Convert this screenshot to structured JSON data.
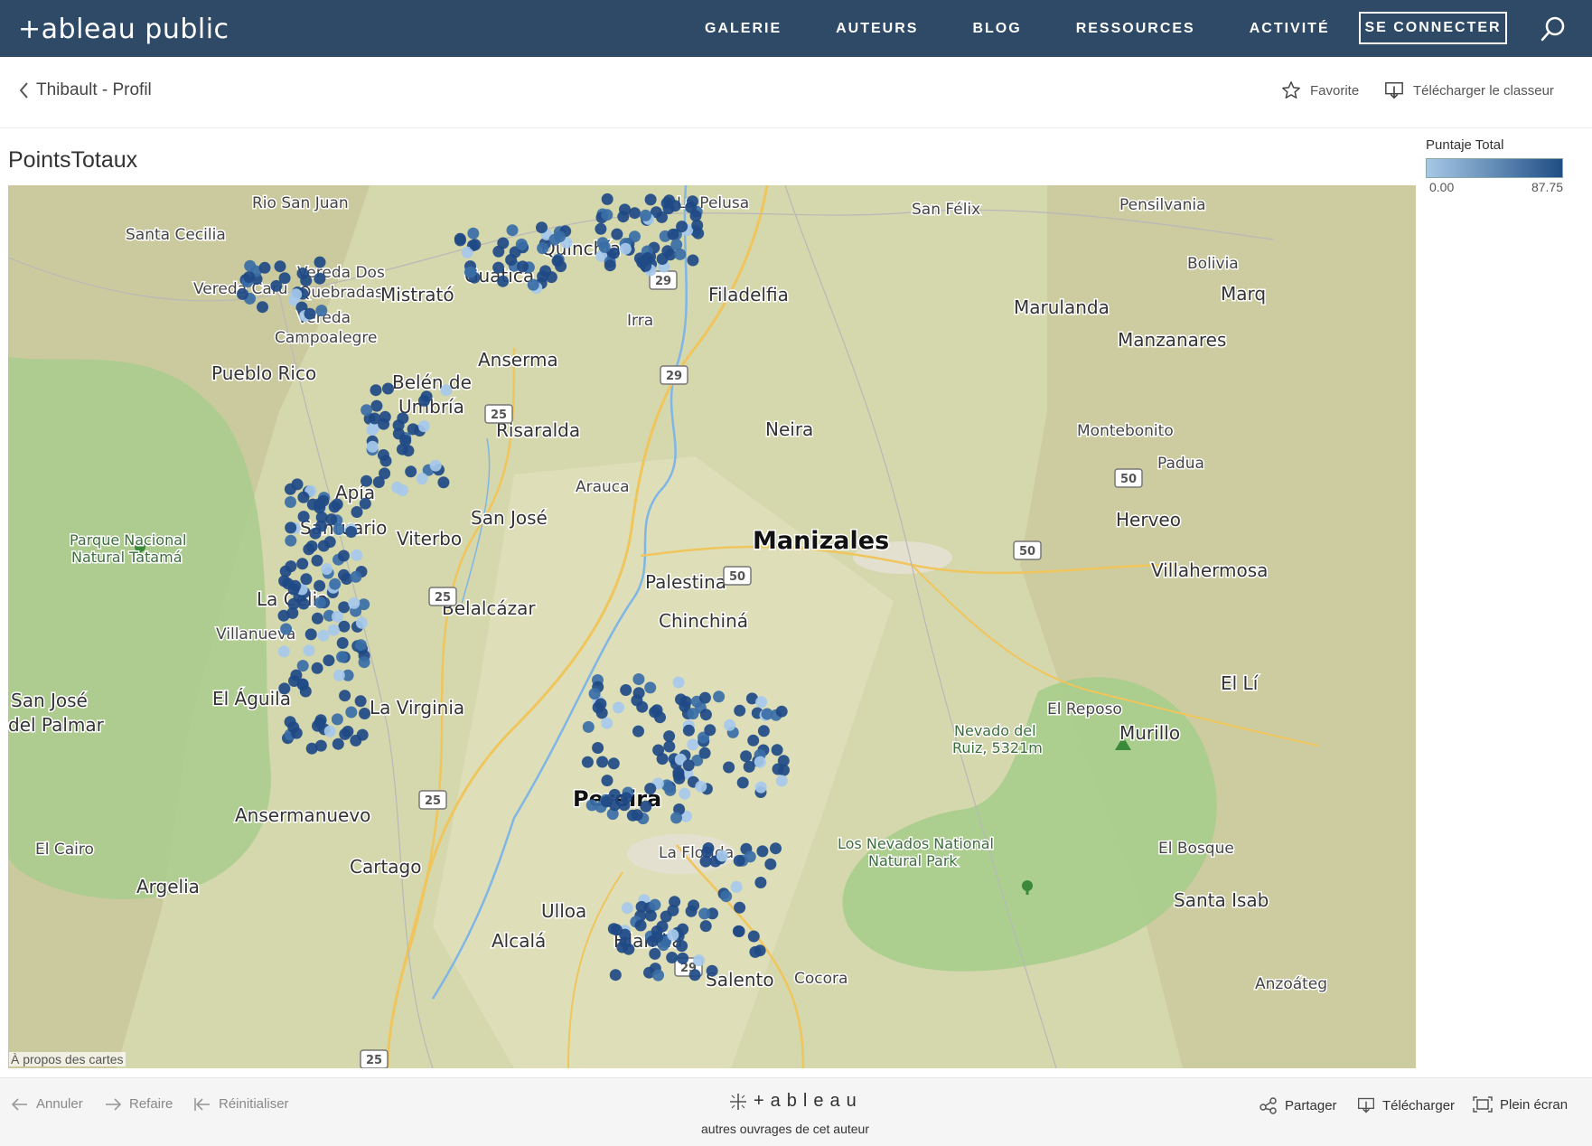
{
  "nav": {
    "logo": "+ableau public",
    "links": [
      "GALERIE",
      "AUTEURS",
      "BLOG",
      "RESSOURCES",
      "ACTIVITÉ"
    ],
    "login": "SE CONNECTER"
  },
  "subheader": {
    "back": "Thibault - Profil",
    "favorite": "Favorite",
    "download_workbook": "Télécharger le classeur"
  },
  "viz": {
    "title": "PointsTotaux",
    "legend": {
      "title": "Puntaje Total",
      "min": "0.00",
      "max": "87.75",
      "color_low": "#a7c8e6",
      "color_high": "#1f4e85"
    },
    "attribution": "À propos des cartes"
  },
  "map_labels": [
    {
      "text": "Rio San Juan",
      "cls": "town"
    },
    {
      "text": "La Pelusa",
      "cls": "town"
    },
    {
      "text": "San Félix",
      "cls": "town"
    },
    {
      "text": "Pensilvania",
      "cls": "town"
    },
    {
      "text": "Santa Cecilia",
      "cls": "town"
    },
    {
      "text": "Vereda Dos",
      "cls": "town"
    },
    {
      "text": "Quebradas",
      "cls": "town"
    },
    {
      "text": "Vereda Caru",
      "cls": "town"
    },
    {
      "text": "Mistrató",
      "cls": "city"
    },
    {
      "text": "Guática",
      "cls": "city"
    },
    {
      "text": "Quinchía",
      "cls": "city"
    },
    {
      "text": "Filadelfia",
      "cls": "city"
    },
    {
      "text": "Bolivia",
      "cls": "town"
    },
    {
      "text": "Marulanda",
      "cls": "city"
    },
    {
      "text": "Marq",
      "cls": "city"
    },
    {
      "text": "Vereda",
      "cls": "town"
    },
    {
      "text": "Campoalegre",
      "cls": "town"
    },
    {
      "text": "Irra",
      "cls": "town"
    },
    {
      "text": "Manzanares",
      "cls": "city"
    },
    {
      "text": "Pueblo Rico",
      "cls": "city"
    },
    {
      "text": "Anserma",
      "cls": "city"
    },
    {
      "text": "Belén de",
      "cls": "city"
    },
    {
      "text": "Umbría",
      "cls": "city"
    },
    {
      "text": "Risaralda",
      "cls": "city"
    },
    {
      "text": "Neira",
      "cls": "city"
    },
    {
      "text": "Montebonito",
      "cls": "town"
    },
    {
      "text": "Padua",
      "cls": "town"
    },
    {
      "text": "Arauca",
      "cls": "town"
    },
    {
      "text": "Apía",
      "cls": "city"
    },
    {
      "text": "Santuario",
      "cls": "city"
    },
    {
      "text": "San José",
      "cls": "city"
    },
    {
      "text": "Viterbo",
      "cls": "city"
    },
    {
      "text": "Manizales",
      "cls": "capital"
    },
    {
      "text": "Herveo",
      "cls": "city"
    },
    {
      "text": "Parque Nacional",
      "cls": "park"
    },
    {
      "text": "Natural Tatamá",
      "cls": "park"
    },
    {
      "text": "Palestina",
      "cls": "city"
    },
    {
      "text": "Villahermosa",
      "cls": "city"
    },
    {
      "text": "La Celia",
      "cls": "city"
    },
    {
      "text": "Belalcázar",
      "cls": "city"
    },
    {
      "text": "Chinchiná",
      "cls": "city"
    },
    {
      "text": "Villanueva",
      "cls": "town"
    },
    {
      "text": "El Águila",
      "cls": "city"
    },
    {
      "text": "San José",
      "cls": "city"
    },
    {
      "text": "del Palmar",
      "cls": "city"
    },
    {
      "text": "La Virginia",
      "cls": "city"
    },
    {
      "text": "El Lí",
      "cls": "city"
    },
    {
      "text": "El Reposo",
      "cls": "town"
    },
    {
      "text": "Nevado del",
      "cls": "park"
    },
    {
      "text": "Ruiz, 5321m",
      "cls": "park"
    },
    {
      "text": "Murillo",
      "cls": "city"
    },
    {
      "text": "Pereira",
      "cls": "capital2"
    },
    {
      "text": "Ansermanuevo",
      "cls": "city"
    },
    {
      "text": "Los Nevados National",
      "cls": "park"
    },
    {
      "text": "Natural Park",
      "cls": "park"
    },
    {
      "text": "El Cairo",
      "cls": "town"
    },
    {
      "text": "La Florida",
      "cls": "town"
    },
    {
      "text": "El Bosque",
      "cls": "town"
    },
    {
      "text": "Cartago",
      "cls": "city"
    },
    {
      "text": "Argelia",
      "cls": "city"
    },
    {
      "text": "Santa Isab",
      "cls": "city"
    },
    {
      "text": "Ulloa",
      "cls": "city"
    },
    {
      "text": "Alcalá",
      "cls": "city"
    },
    {
      "text": "Filandia",
      "cls": "city"
    },
    {
      "text": "Salento",
      "cls": "city"
    },
    {
      "text": "Cocora",
      "cls": "town"
    },
    {
      "text": "Anzoáteg",
      "cls": "town"
    }
  ],
  "route_shields": [
    "29",
    "29",
    "25",
    "25",
    "25",
    "50",
    "50",
    "50",
    "29",
    "25"
  ],
  "toolbar": {
    "undo": "Annuler",
    "redo": "Refaire",
    "reset": "Réinitialiser",
    "brand": "+ableau",
    "other_works": "autres ouvrages de cet auteur",
    "share": "Partager",
    "download": "Télécharger",
    "fullscreen": "Plein écran"
  }
}
